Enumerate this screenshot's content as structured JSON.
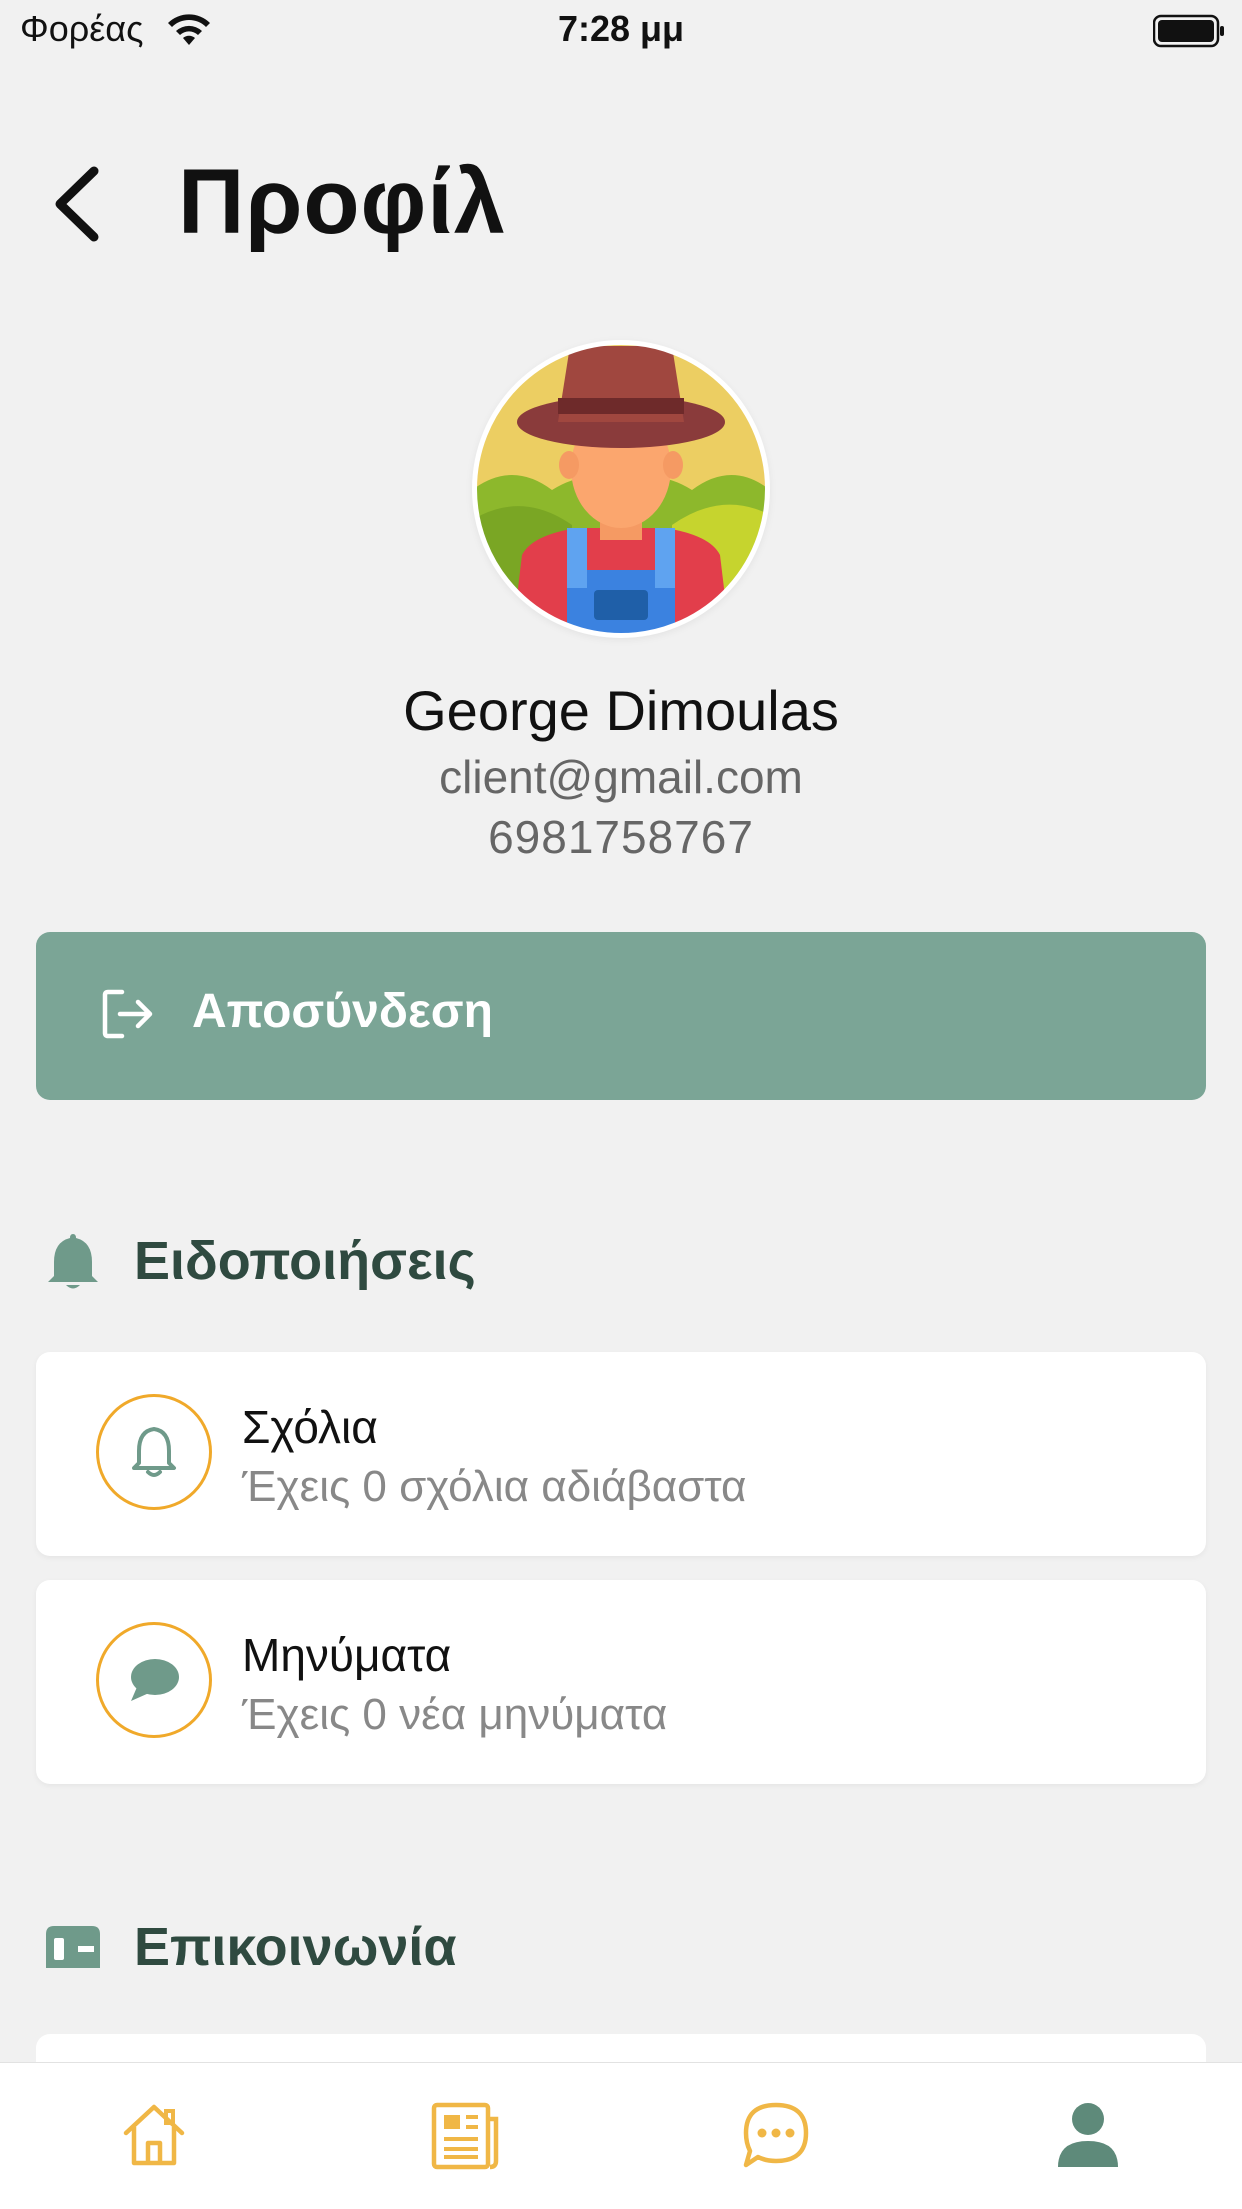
{
  "status_bar": {
    "carrier": "Φορέας",
    "time": "7:28 μμ"
  },
  "header": {
    "title": "Προφίλ"
  },
  "profile": {
    "name": "George Dimoulas",
    "email": "client@gmail.com",
    "phone": "6981758767"
  },
  "logout": {
    "label": "Αποσύνδεση"
  },
  "notifications": {
    "title": "Ειδοποιήσεις",
    "items": [
      {
        "title": "Σχόλια",
        "subtitle": "Έχεις 0 σχόλια αδιάβαστα",
        "icon": "bell-icon"
      },
      {
        "title": "Μηνύματα",
        "subtitle": "Έχεις 0 νέα μηνύματα",
        "icon": "chat-bubble-icon"
      }
    ]
  },
  "contact": {
    "title": "Επικοινωνία"
  },
  "tabbar": {
    "tabs": [
      {
        "icon": "home-icon",
        "active": false
      },
      {
        "icon": "news-icon",
        "active": false
      },
      {
        "icon": "chat-icon",
        "active": false
      },
      {
        "icon": "profile-icon",
        "active": true
      }
    ]
  },
  "colors": {
    "background": "#f1f1f1",
    "accent_green": "#7ba596",
    "section_title": "#2f4a40",
    "icon_orange": "#f0a92a",
    "active_tab": "#5e8a7a"
  }
}
